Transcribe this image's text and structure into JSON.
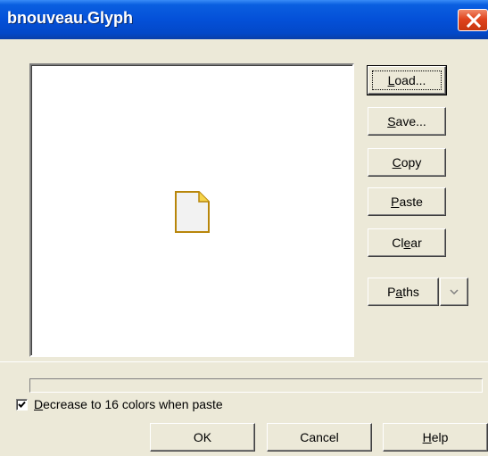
{
  "window": {
    "title": "bnouveau.Glyph",
    "close_icon": "close-icon"
  },
  "preview": {
    "icon": "blank-document-icon"
  },
  "buttons": {
    "load": {
      "pre": "",
      "mn": "L",
      "post": "oad..."
    },
    "save": {
      "pre": "",
      "mn": "S",
      "post": "ave..."
    },
    "copy": {
      "pre": "",
      "mn": "C",
      "post": "opy"
    },
    "paste": {
      "pre": "",
      "mn": "P",
      "post": "aste"
    },
    "clear": {
      "pre": "Cl",
      "mn": "e",
      "post": "ar"
    },
    "paths": {
      "pre": "P",
      "mn": "a",
      "post": "ths"
    },
    "paths_arrow_icon": "chevron-down-icon"
  },
  "checkbox": {
    "checked": true,
    "pre": "",
    "mn": "D",
    "post": "ecrease to 16 colors when paste"
  },
  "footer": {
    "ok": "OK",
    "cancel": "Cancel",
    "help": {
      "pre": "",
      "mn": "H",
      "post": "elp"
    }
  },
  "colors": {
    "titlebar": "#0450d8",
    "dialog_bg": "#ece9d8",
    "close_button": "#e0441e"
  }
}
